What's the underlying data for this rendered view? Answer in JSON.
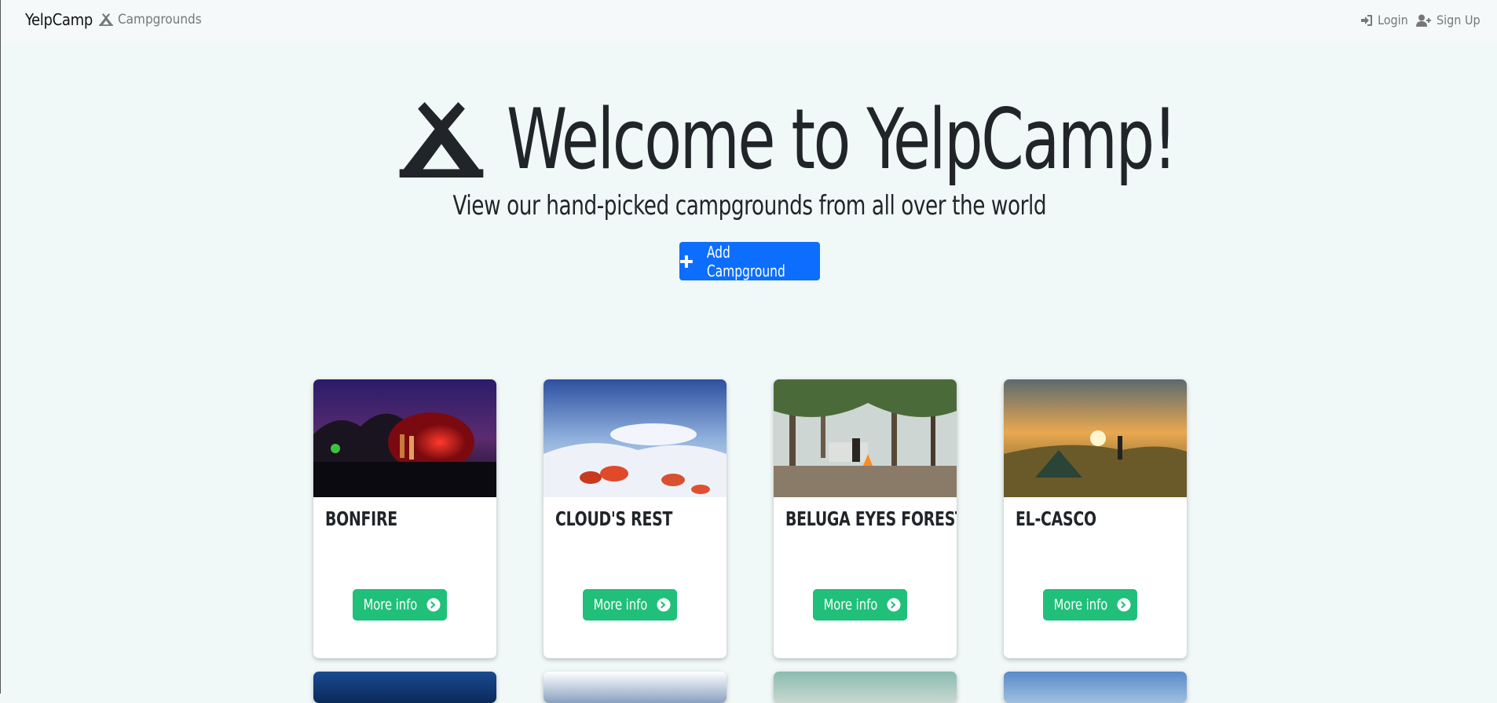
{
  "nav": {
    "brand": "YelpCamp",
    "campgrounds_label": "Campgrounds",
    "login_label": "Login",
    "signup_label": "Sign Up"
  },
  "hero": {
    "title": "Welcome to YelpCamp!",
    "subtitle": "View our hand-picked campgrounds from all over the world",
    "add_button_label": "Add Campground"
  },
  "cards": [
    {
      "title": "BONFIRE",
      "button_label": "More info"
    },
    {
      "title": "CLOUD'S REST",
      "button_label": "More info"
    },
    {
      "title": "BELUGA EYES FOREST",
      "button_label": "More info"
    },
    {
      "title": "EL-CASCO",
      "button_label": "More info"
    }
  ],
  "colors": {
    "primary": "#0d6efd",
    "success": "#20c07a",
    "background": "#f1f8f8"
  },
  "icons": [
    "campground-icon",
    "sign-in-icon",
    "user-plus-icon",
    "plus-icon",
    "chevron-circle-right-icon"
  ]
}
